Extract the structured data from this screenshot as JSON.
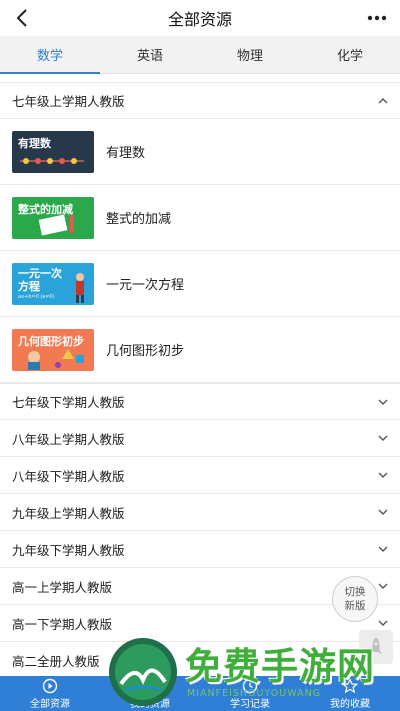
{
  "header": {
    "title": "全部资源"
  },
  "tabs": [
    {
      "label": "数学",
      "active": true
    },
    {
      "label": "英语",
      "active": false
    },
    {
      "label": "物理",
      "active": false
    },
    {
      "label": "化学",
      "active": false
    }
  ],
  "expanded_section": {
    "title": "七年级上学期人教版",
    "lessons": [
      {
        "name": "有理数",
        "thumb_title": "有理数",
        "color": "#27384a"
      },
      {
        "name": "整式的加减",
        "thumb_title": "整式的加减",
        "color": "#2aa84a"
      },
      {
        "name": "一元一次方程",
        "thumb_title": "一元一次\n方程",
        "thumb_sub": "ax+b=0 (a≠0)",
        "color": "#2aa3d8"
      },
      {
        "name": "几何图形初步",
        "thumb_title": "几何图形初步",
        "color": "#f17a52"
      }
    ]
  },
  "collapsed_sections": [
    "七年级下学期人教版",
    "八年级上学期人教版",
    "八年级下学期人教版",
    "九年级上学期人教版",
    "九年级下学期人教版",
    "高一上学期人教版",
    "高一下学期人教版",
    "高二全册人教版"
  ],
  "switch_button": {
    "line1": "切换",
    "line2": "新版"
  },
  "bottom_nav": [
    {
      "label": "全部资源",
      "icon": "play-circle-icon"
    },
    {
      "label": "我的资源",
      "icon": "folder-icon"
    },
    {
      "label": "学习记录",
      "icon": "clock-icon"
    },
    {
      "label": "我的收藏",
      "icon": "star-icon"
    }
  ],
  "watermark": {
    "text": "免费手游网",
    "sub": "MIANFEISHOUYOUWANG"
  },
  "colors": {
    "accent": "#2f7fd6",
    "watermark": "#3fae3a"
  }
}
